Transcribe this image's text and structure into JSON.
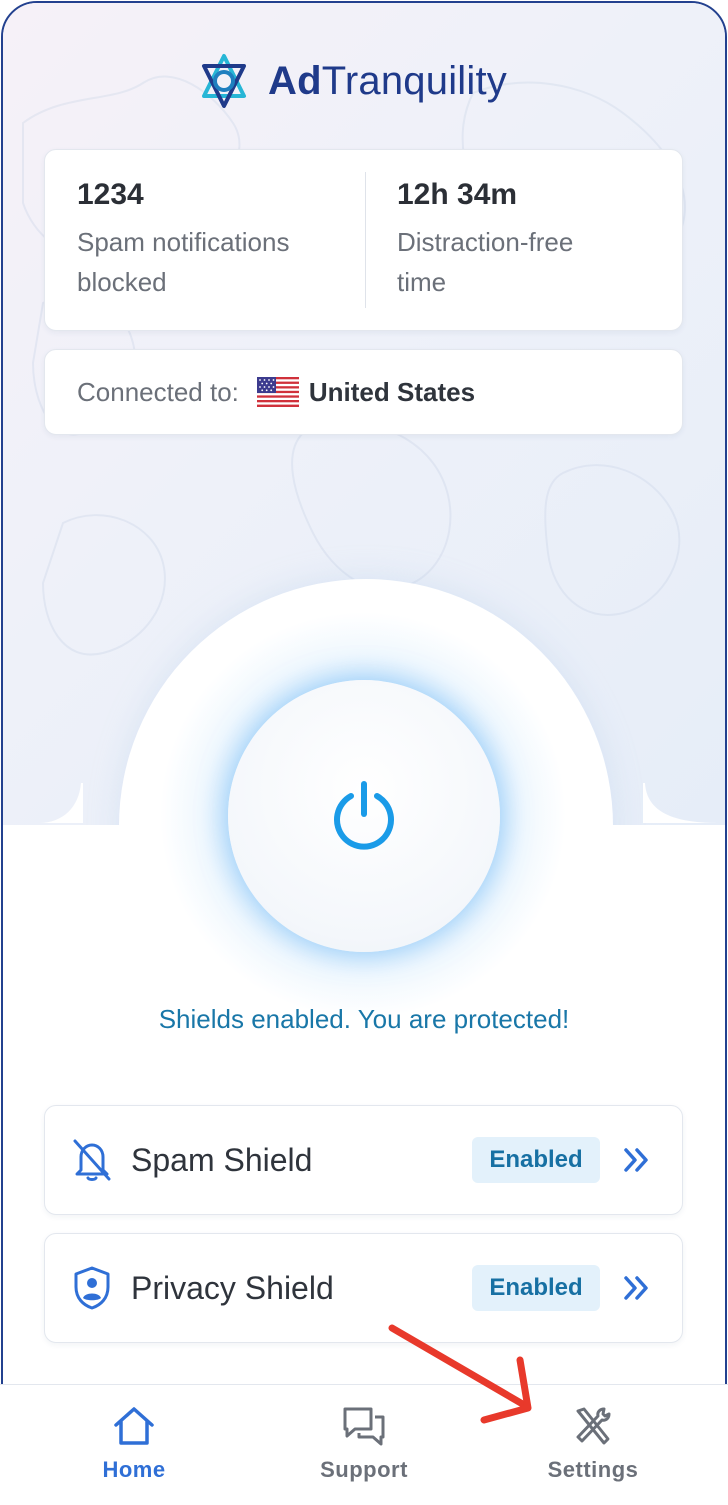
{
  "brand": {
    "bold": "Ad",
    "regular": "Tranquility"
  },
  "stats": [
    {
      "value": "1234",
      "label_line1": "Spam notifications",
      "label_line2": "blocked"
    },
    {
      "value": "12h 34m",
      "label_line1": "Distraction-free",
      "label_line2": "time"
    }
  ],
  "connection": {
    "label": "Connected to:",
    "country": "United States",
    "flag_icon": "us-flag-icon"
  },
  "power": {
    "icon": "power-icon",
    "state": "on"
  },
  "status_message": "Shields enabled. You are protected!",
  "shields": [
    {
      "name": "Spam Shield",
      "status": "Enabled",
      "icon": "bell-off-icon"
    },
    {
      "name": "Privacy Shield",
      "status": "Enabled",
      "icon": "shield-user-icon"
    }
  ],
  "tabs": [
    {
      "label": "Home",
      "icon": "home-icon",
      "active": true
    },
    {
      "label": "Support",
      "icon": "chat-icon",
      "active": false
    },
    {
      "label": "Settings",
      "icon": "tools-icon",
      "active": false
    }
  ],
  "colors": {
    "brand_blue": "#1f3a8a",
    "accent_blue": "#2f6fd6",
    "power_blue": "#1a9be8",
    "status_teal": "#1977a8",
    "badge_bg": "#e3f1fb",
    "arrow_red": "#e8392b",
    "inactive_gray": "#6b7079"
  }
}
